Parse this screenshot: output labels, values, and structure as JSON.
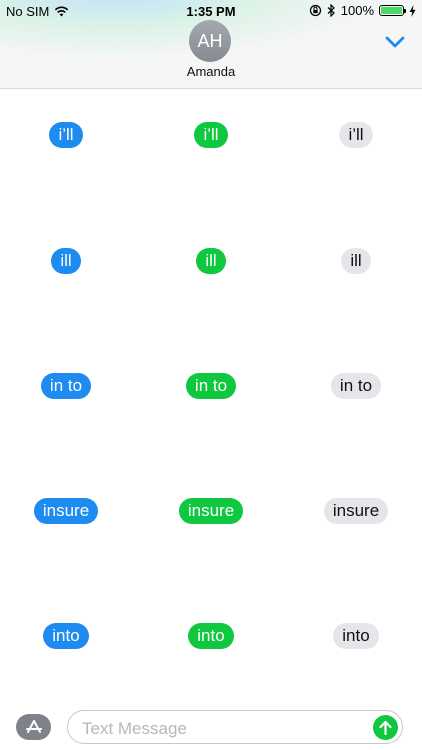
{
  "status_bar": {
    "carrier": "No SIM",
    "time": "1:35 PM",
    "battery": "100%",
    "battery_level": 1.0,
    "battery_color": "#4cd964",
    "icons": [
      "wifi-icon",
      "orientation-lock-icon",
      "bluetooth-icon",
      "battery-icon",
      "charging-bolt-icon"
    ]
  },
  "header": {
    "avatar_initials": "AH",
    "contact_name": "Amanda",
    "collapse_icon": "chevron-down-icon",
    "accent_color": "#1d8bf0"
  },
  "stickers": {
    "colors": {
      "blue": "#1d8bf0",
      "green": "#10c740",
      "gray": "#e6e6ea"
    },
    "rows": [
      {
        "word": "i’ll",
        "blue": "i’ll",
        "green": "i’ll",
        "gray": "i’ll"
      },
      {
        "word": "ill",
        "blue": "ill",
        "green": "ill",
        "gray": "ill"
      },
      {
        "word": "in to",
        "blue": "in to",
        "green": "in to",
        "gray": "in to"
      },
      {
        "word": "insure",
        "blue": "insure",
        "green": "insure",
        "gray": "insure"
      },
      {
        "word": "into",
        "blue": "into",
        "green": "into",
        "gray": "into"
      }
    ]
  },
  "composer": {
    "app_button_icon": "app-store-icon",
    "placeholder": "Text Message",
    "send_icon": "arrow-up-icon"
  }
}
